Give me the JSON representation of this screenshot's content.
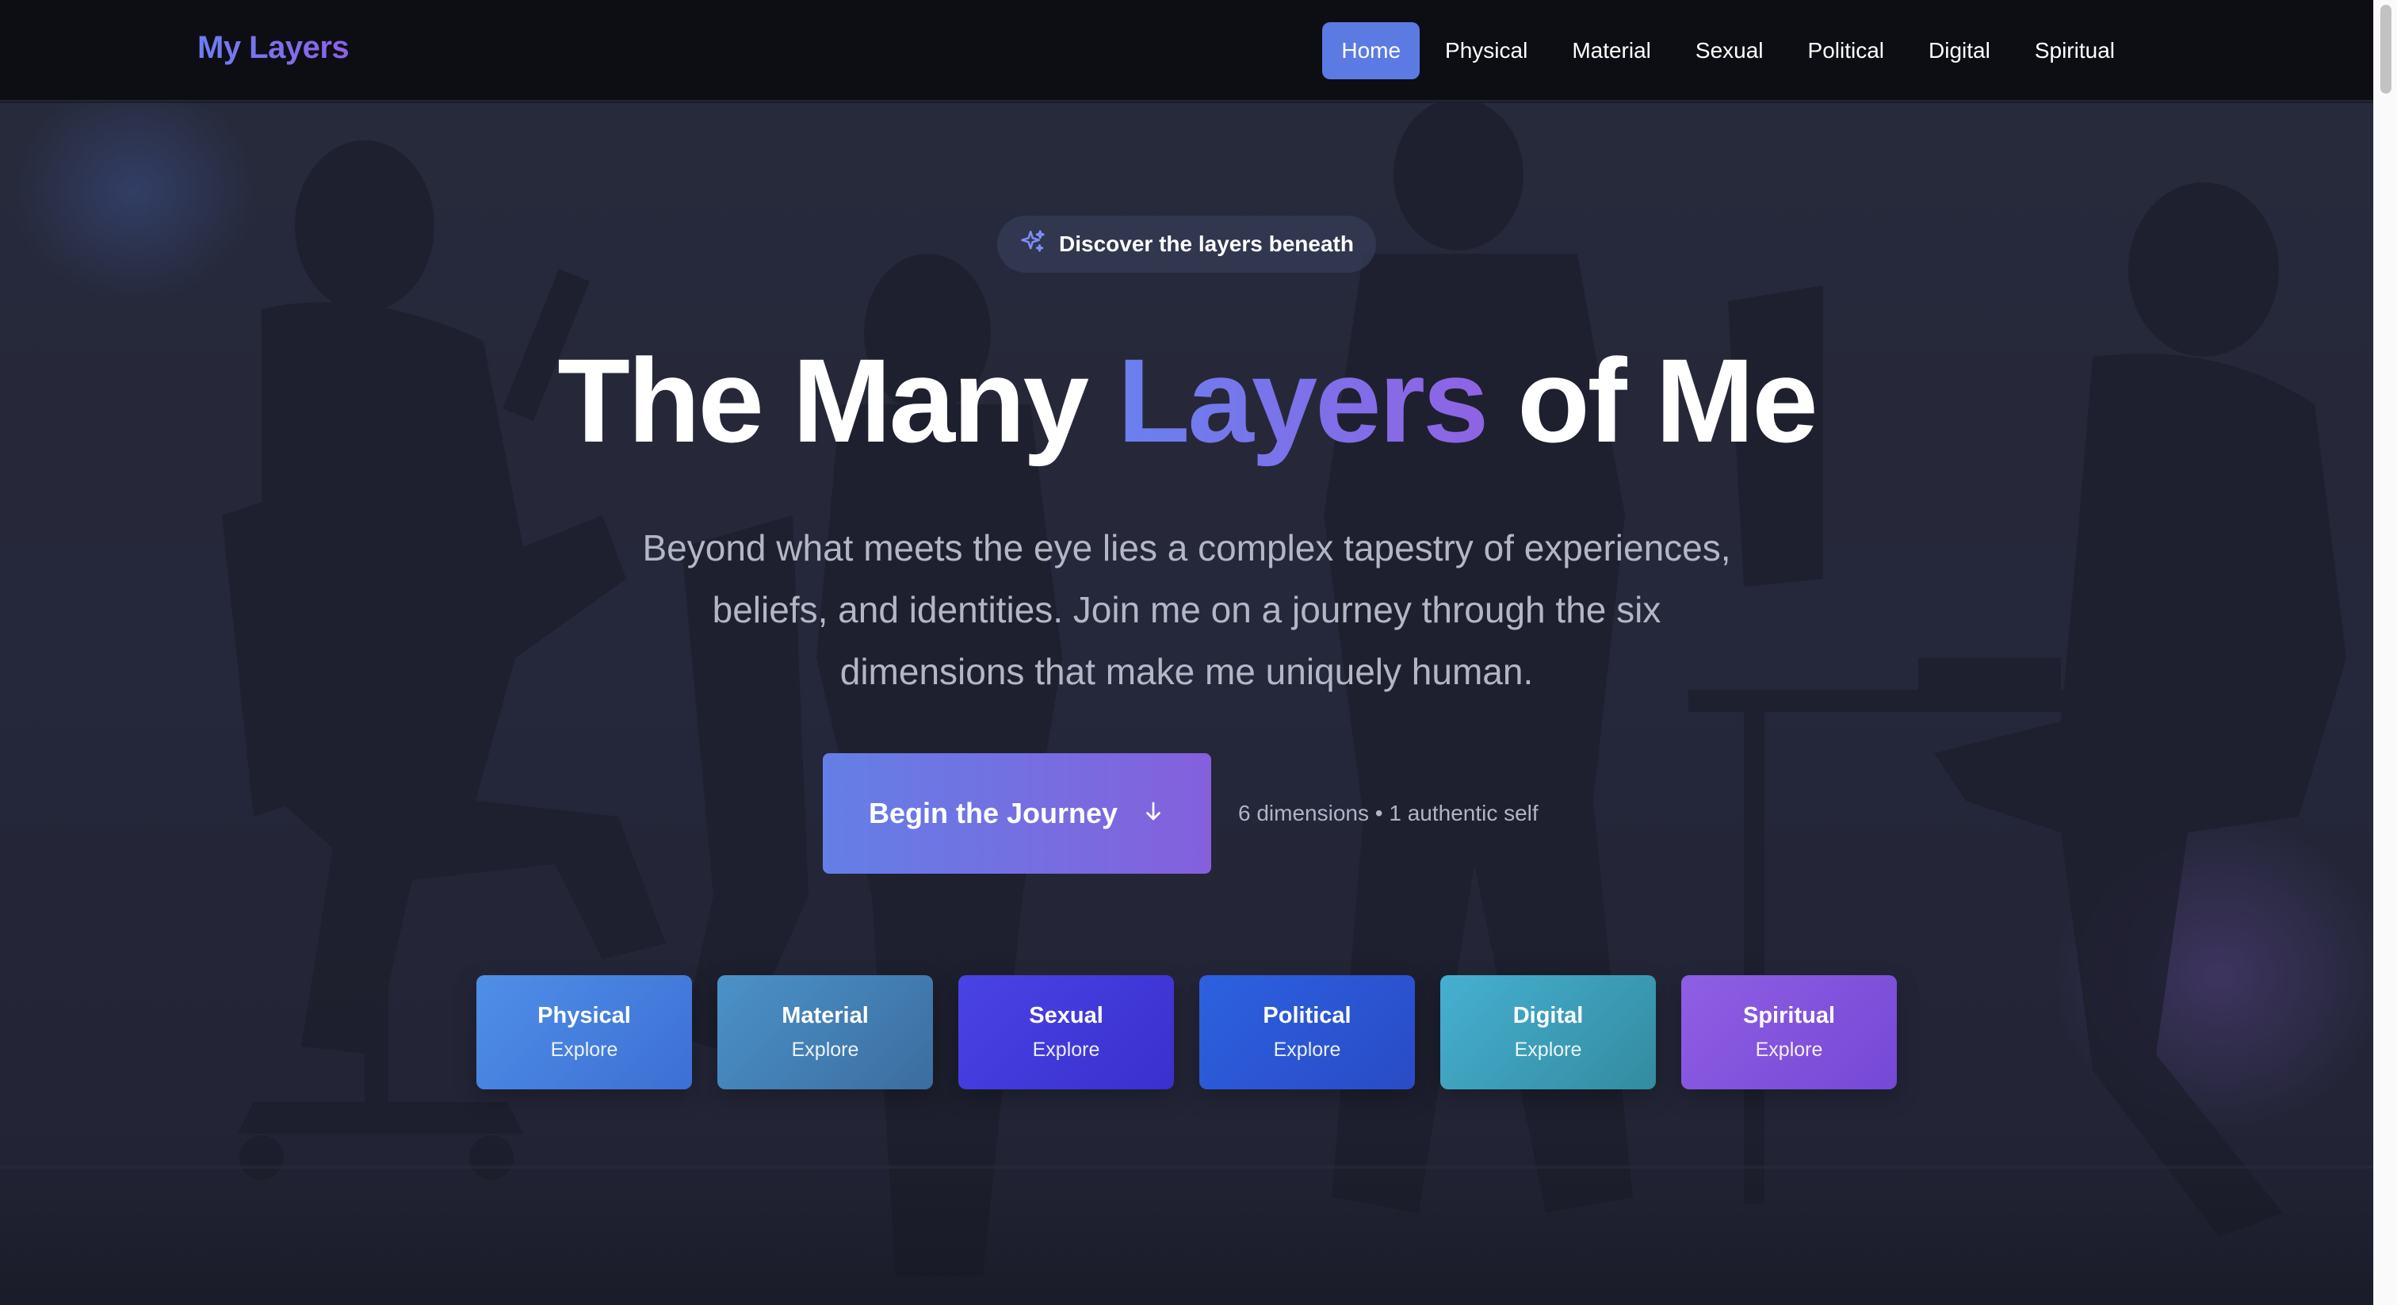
{
  "nav": {
    "brand": "My Layers",
    "links": [
      {
        "label": "Home",
        "active": true
      },
      {
        "label": "Physical",
        "active": false
      },
      {
        "label": "Material",
        "active": false
      },
      {
        "label": "Sexual",
        "active": false
      },
      {
        "label": "Political",
        "active": false
      },
      {
        "label": "Digital",
        "active": false
      },
      {
        "label": "Spiritual",
        "active": false
      }
    ]
  },
  "hero": {
    "badge": {
      "icon": "sparkles-icon",
      "text": "Discover the layers beneath"
    },
    "headline": {
      "before": "The Many ",
      "accent": "Layers",
      "after": " of Me"
    },
    "subtitle": "Beyond what meets the eye lies a complex tapestry of experiences, beliefs, and identities. Join me on a journey through the six dimensions that make me uniquely human.",
    "cta": {
      "label": "Begin the Journey",
      "icon": "arrow-down-icon"
    },
    "meta": "6 dimensions • 1 authentic self"
  },
  "cards": [
    {
      "title": "Physical",
      "subtitle": "Explore"
    },
    {
      "title": "Material",
      "subtitle": "Explore"
    },
    {
      "title": "Sexual",
      "subtitle": "Explore"
    },
    {
      "title": "Political",
      "subtitle": "Explore"
    },
    {
      "title": "Digital",
      "subtitle": "Explore"
    },
    {
      "title": "Spiritual",
      "subtitle": "Explore"
    }
  ],
  "colors": {
    "nav_background": "#0d0e13",
    "active_nav": "#5b7be3",
    "accent_start": "#6a80ee",
    "accent_end": "#8f63e4",
    "hero_background": "#25273a"
  }
}
